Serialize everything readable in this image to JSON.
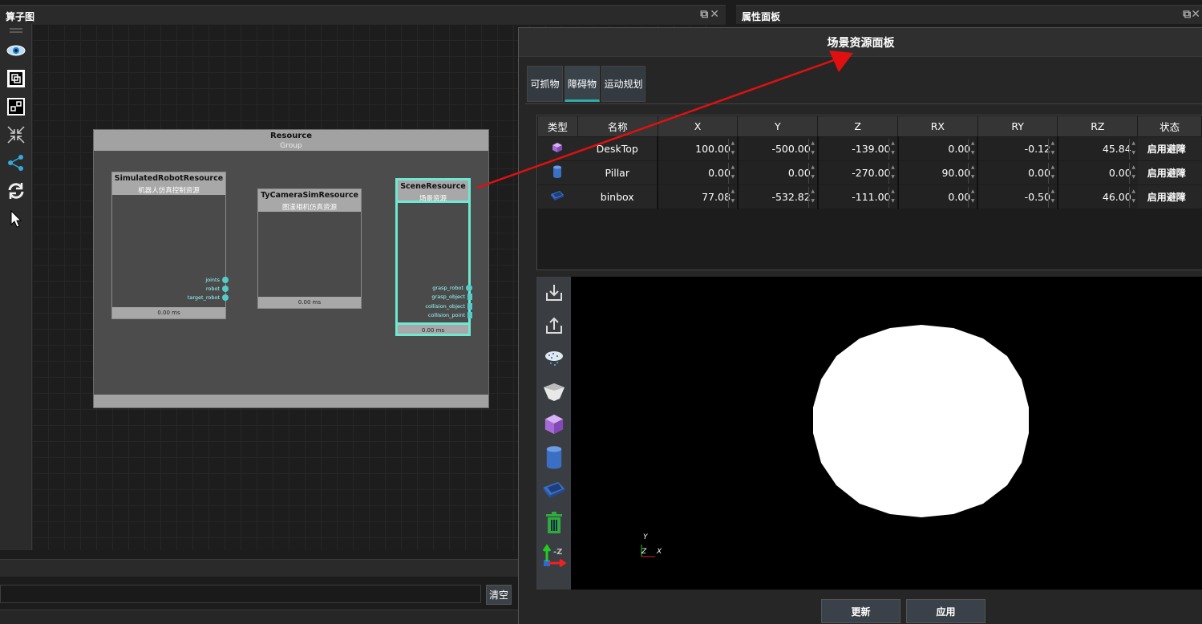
{
  "left_dock": {
    "title": "算子图"
  },
  "right_dock": {
    "title": "属性面板"
  },
  "graph": {
    "group": {
      "title": "Resource",
      "subtitle": "Group"
    },
    "nodes": [
      {
        "title": "SimulatedRobotResource",
        "subtitle": "机器人仿真控制资源",
        "footer": "0.00 ms",
        "ports": [
          "joints",
          "robot",
          "target_robot"
        ]
      },
      {
        "title": "TyCameraSimResource",
        "subtitle": "图漾相机仿真资源",
        "footer": "0.00 ms",
        "ports": []
      },
      {
        "title": "SceneResource",
        "subtitle": "场景资源",
        "footer": "0.00 ms",
        "ports": [
          "grasp_robot",
          "grasp_object",
          "collision_object",
          "collision_point"
        ]
      }
    ]
  },
  "log": {
    "clear_label": "清空"
  },
  "scene_panel": {
    "title": "场景资源面板",
    "tabs": [
      "可抓物",
      "障碍物",
      "运动规划"
    ],
    "active_tab": "障碍物",
    "table": {
      "headers": [
        "类型",
        "名称",
        "X",
        "Y",
        "Z",
        "RX",
        "RY",
        "RZ",
        "状态"
      ],
      "rows": [
        {
          "type_icon": "cube-icon",
          "name": "DeskTop",
          "x": "100.00",
          "y": "-500.00",
          "z": "-139.00",
          "rx": "0.00",
          "ry": "-0.12",
          "rz": "45.84",
          "status": "启用避障"
        },
        {
          "type_icon": "cylinder-icon",
          "name": "Pillar",
          "x": "0.00",
          "y": "0.00",
          "z": "-270.00",
          "rx": "90.00",
          "ry": "0.00",
          "rz": "0.00",
          "status": "启用避障"
        },
        {
          "type_icon": "bin-icon",
          "name": "binbox",
          "x": "77.08",
          "y": "-532.82",
          "z": "-111.00",
          "rx": "0.00",
          "ry": "-0.50",
          "rz": "46.00",
          "status": "启用避障"
        }
      ]
    },
    "axis": {
      "y": "Y",
      "z": "Z",
      "x": "X"
    },
    "update_label": "更新",
    "apply_label": "应用",
    "colors": {
      "selection": "#6ee8d0",
      "arrow": "#e11010"
    }
  }
}
